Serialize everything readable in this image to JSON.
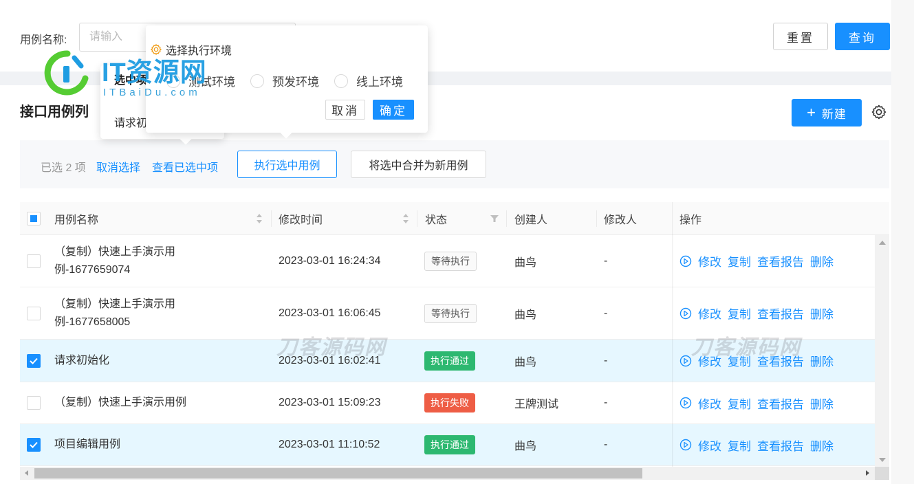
{
  "search": {
    "label": "用例名称:",
    "placeholder": "请输入",
    "value": "",
    "reset_label": "重置",
    "query_label": "查询"
  },
  "list": {
    "title": "接口用例列",
    "new_label": "新建",
    "new_icon": "plus-icon",
    "settings_icon": "gear-icon"
  },
  "selection_bar": {
    "count_text": "已选 2 项",
    "cancel_label": "取消选择",
    "view_label": "查看已选中项",
    "run_label": "执行选中用例",
    "merge_label": "将选中合并为新用例"
  },
  "selected_popover": {
    "title": "选中项",
    "body": "请求初"
  },
  "env_popover": {
    "title": "选择执行环境",
    "icon": "gear-icon",
    "options": [
      {
        "label": "测试环境",
        "checked": false
      },
      {
        "label": "预发环境",
        "checked": false
      },
      {
        "label": "线上环境",
        "checked": false
      }
    ],
    "cancel_label": "取消",
    "ok_label": "确定"
  },
  "table": {
    "columns": [
      {
        "label": "用例名称",
        "sortable": true
      },
      {
        "label": "修改时间",
        "sortable": true
      },
      {
        "label": "状态",
        "filterable": true
      },
      {
        "label": "创建人"
      },
      {
        "label": "修改人"
      },
      {
        "label": "操作"
      }
    ],
    "header_checkbox": "indeterminate",
    "rows": [
      {
        "checked": false,
        "name": "（复制）快速上手演示用例-1677659074",
        "name_line1": "（复制）快速上手演示用",
        "name_line2": "例-1677659074",
        "time": "2023-03-01 16:24:34",
        "status": "等待执行",
        "status_type": "waiting",
        "creator": "曲鸟",
        "modifier": "-"
      },
      {
        "checked": false,
        "name": "（复制）快速上手演示用例-1677658005",
        "name_line1": "（复制）快速上手演示用",
        "name_line2": "例-1677658005",
        "time": "2023-03-01 16:06:45",
        "status": "等待执行",
        "status_type": "waiting",
        "creator": "曲鸟",
        "modifier": "-"
      },
      {
        "checked": true,
        "name": "请求初始化",
        "name_line1": "请求初始化",
        "name_line2": "",
        "time": "2023-03-01 16:02:41",
        "status": "执行通过",
        "status_type": "pass",
        "creator": "曲鸟",
        "modifier": "-"
      },
      {
        "checked": false,
        "name": "（复制）快速上手演示用例",
        "name_line1": "（复制）快速上手演示用例",
        "name_line2": "",
        "time": "2023-03-01 15:09:23",
        "status": "执行失败",
        "status_type": "fail",
        "creator": "王牌测试",
        "modifier": "-"
      },
      {
        "checked": true,
        "name": "项目编辑用例",
        "name_line1": "项目编辑用例",
        "name_line2": "",
        "time": "2023-03-01 11:10:52",
        "status": "执行通过",
        "status_type": "pass",
        "creator": "曲鸟",
        "modifier": "-"
      }
    ],
    "actions": [
      "修改",
      "复制",
      "查看报告",
      "删除"
    ]
  },
  "colors": {
    "primary": "#1890ff",
    "pass": "#2db870",
    "fail": "#ee5d45",
    "selected_row": "#e6f7ff"
  },
  "watermarks": {
    "logo_text": "IT资源网",
    "logo_sub": "ITBaiDu.com",
    "center_text": "刀客源码网"
  }
}
